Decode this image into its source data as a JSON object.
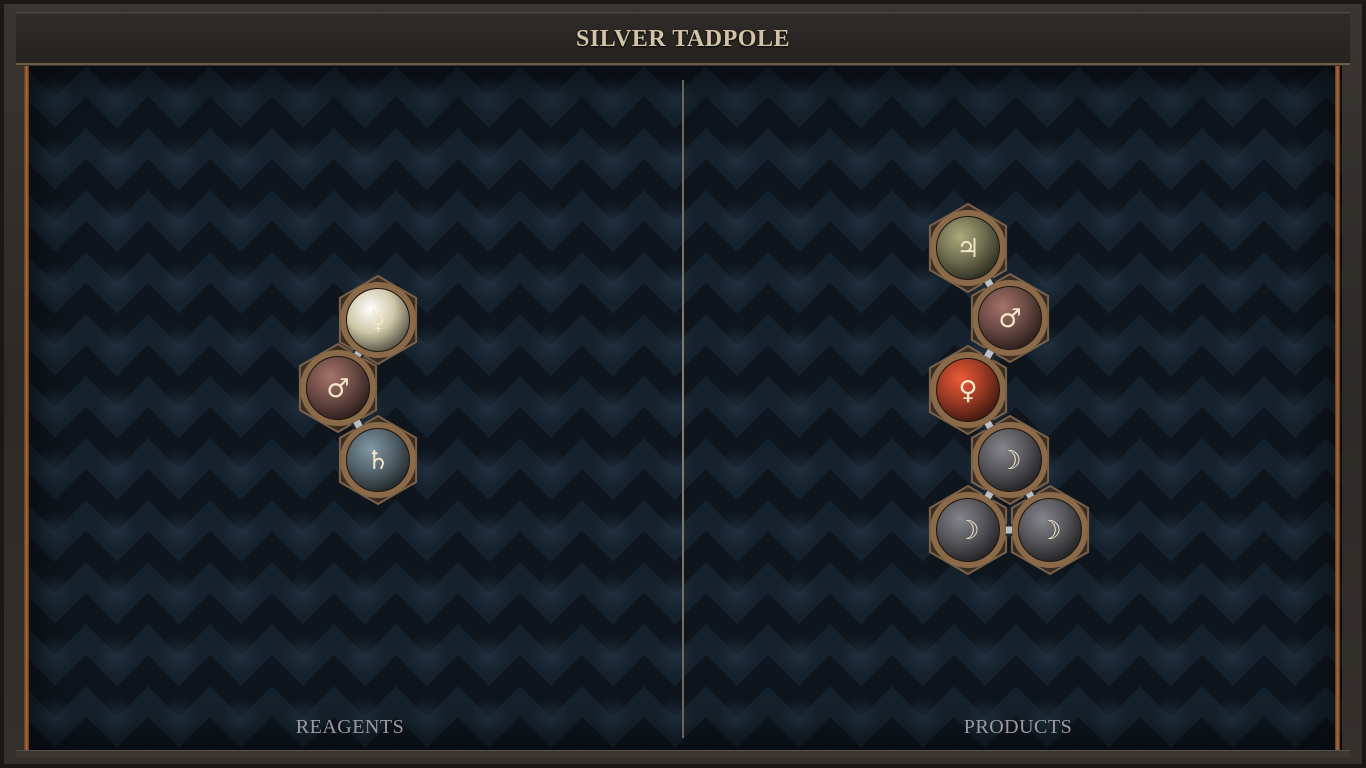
{
  "title": "SILVER TADPOLE",
  "panels": {
    "left_label": "REAGENTS",
    "right_label": "PRODUCTS"
  },
  "colors": {
    "salt": "#cfc8a8",
    "iron": "#6a4a44",
    "lead": "#52626a",
    "tin": "#6e6e50",
    "copper": "#9a3a24",
    "silver": "#55555a",
    "symbol": "#f3e6c8",
    "bronze": "#8a6a48"
  },
  "reagents": {
    "atoms": [
      {
        "element": "quicksilver",
        "symbol": "☿",
        "color": "salt"
      },
      {
        "element": "iron",
        "symbol": "♂",
        "color": "iron"
      },
      {
        "element": "lead",
        "symbol": "♄",
        "color": "lead"
      }
    ],
    "bonds": [
      [
        0,
        1
      ],
      [
        1,
        2
      ]
    ]
  },
  "products": {
    "atoms": [
      {
        "element": "tin",
        "symbol": "♃",
        "color": "tin"
      },
      {
        "element": "iron",
        "symbol": "♂",
        "color": "iron"
      },
      {
        "element": "copper",
        "symbol": "♀",
        "color": "copper"
      },
      {
        "element": "silver",
        "symbol": "☽",
        "color": "silver"
      },
      {
        "element": "silver",
        "symbol": "☽",
        "color": "silver"
      },
      {
        "element": "silver",
        "symbol": "☽",
        "color": "silver"
      }
    ],
    "bonds": [
      [
        0,
        1
      ],
      [
        1,
        2
      ],
      [
        2,
        3
      ],
      [
        3,
        4
      ],
      [
        3,
        5
      ],
      [
        4,
        5
      ]
    ]
  }
}
